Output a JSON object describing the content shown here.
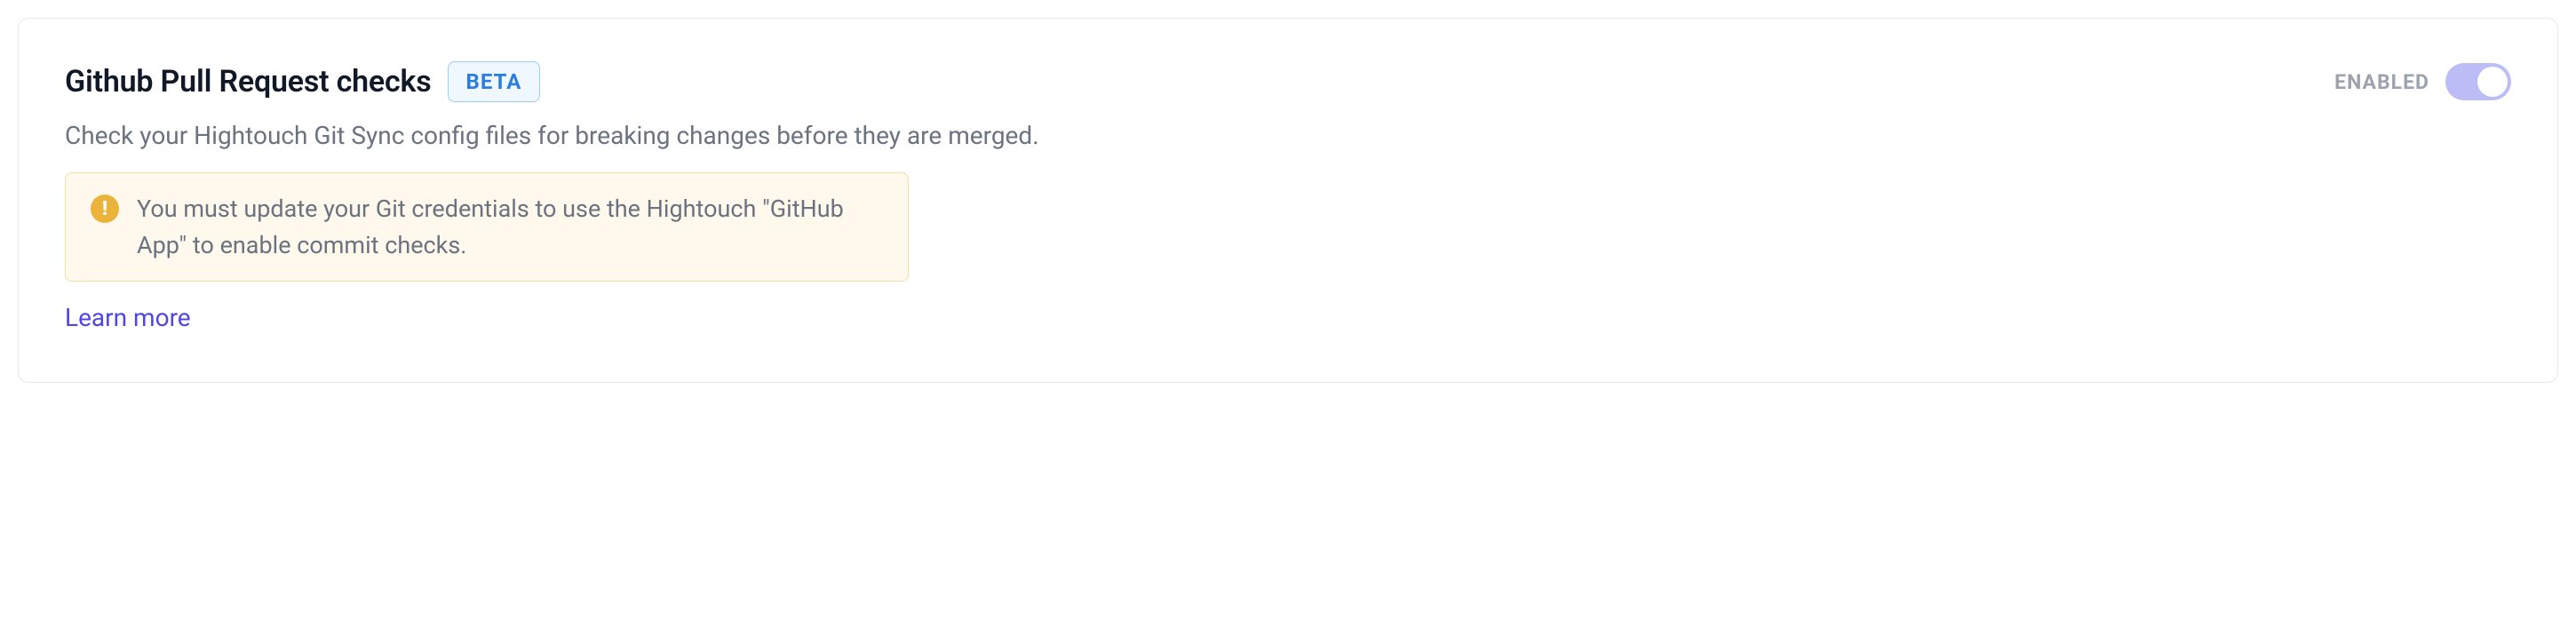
{
  "card": {
    "title": "Github Pull Request checks",
    "badge": "BETA",
    "description": "Check your Hightouch Git Sync config files for breaking changes before they are merged.",
    "warning": "You must update your Git credentials to use the Hightouch \"GitHub App\" to enable commit checks.",
    "learn_more": "Learn more",
    "toggle": {
      "label": "ENABLED",
      "state": "on"
    }
  }
}
